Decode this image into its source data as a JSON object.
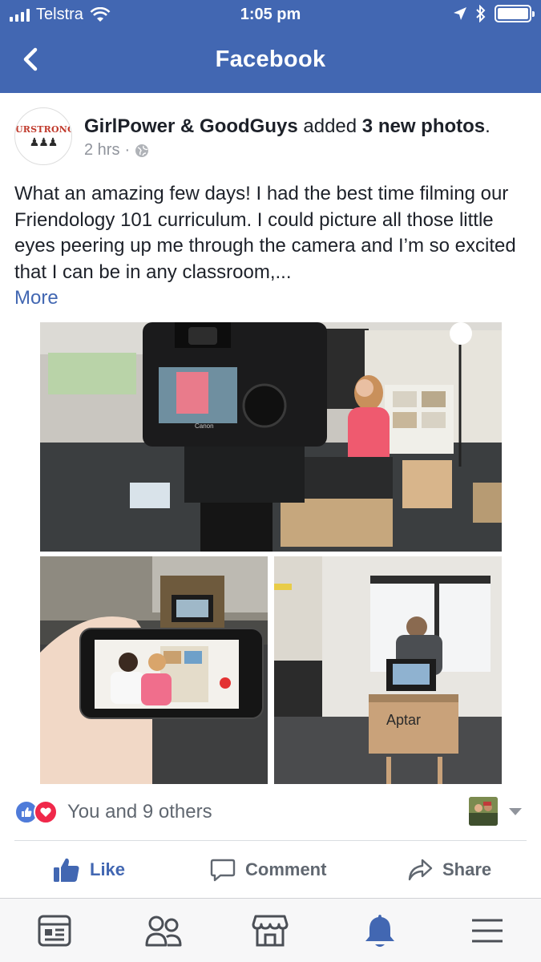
{
  "status_bar": {
    "carrier": "Telstra",
    "time": "1:05 pm",
    "battery_level": 1.0
  },
  "nav": {
    "title": "Facebook",
    "back_icon": "chevron-left-icon"
  },
  "post": {
    "page_avatar_text": "URSTRONG",
    "author": "GirlPower & GoodGuys",
    "action": " added ",
    "photo_count": "3 new photos",
    "period": ".",
    "time_ago": "2 hrs",
    "separator": "·",
    "audience_icon": "globe-icon",
    "text": "What an amazing few days! I had the best time filming our Friendology 101 curriculum. I could picture all those little eyes peering up me through the camera and I’m so excited that I can be in any classroom,...",
    "more_label": "More",
    "photo_text": "Aptar",
    "camera_brand": "Canon"
  },
  "reactions": {
    "summary": "You and 9 others",
    "colors": {
      "like": "#4f7bd9",
      "love": "#f0284a"
    }
  },
  "actions": {
    "like": "Like",
    "comment": "Comment",
    "share": "Share"
  },
  "tabbar": {
    "items": [
      "news-feed-icon",
      "friends-icon",
      "marketplace-icon",
      "notifications-icon",
      "menu-icon"
    ],
    "active": "notifications-icon"
  },
  "colors": {
    "brand": "#4267b2",
    "text": "#1d2129",
    "secondary": "#90949c"
  }
}
